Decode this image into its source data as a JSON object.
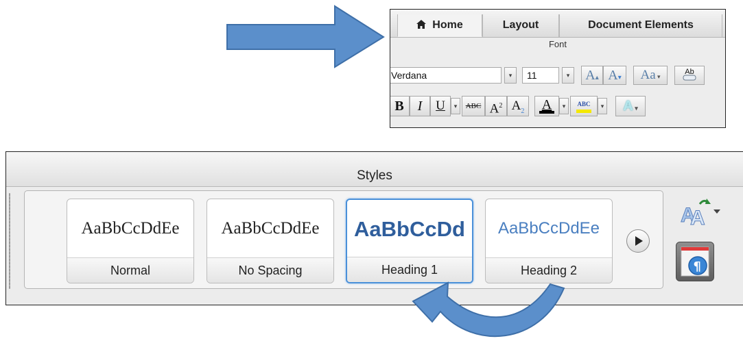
{
  "font_ribbon": {
    "tabs": [
      {
        "label": "Home",
        "icon": "home-icon",
        "active": true
      },
      {
        "label": "Layout",
        "active": false
      },
      {
        "label": "Document Elements",
        "active": false
      }
    ],
    "group_label": "Font",
    "font_name": "Verdana",
    "font_size": "11",
    "grow_font_glyph": "A",
    "shrink_font_glyph": "A",
    "change_case_glyph": "Aa",
    "clear_format_glyph": "Ab",
    "bold_glyph": "B",
    "italic_glyph": "I",
    "underline_glyph": "U",
    "strikethrough_glyph": "ABC",
    "superscript_glyph": "A",
    "superscript_mark": "2",
    "subscript_glyph": "A",
    "subscript_mark": "2",
    "font_color_glyph": "A",
    "highlight_glyph": "ABC",
    "text_effects_glyph": "A"
  },
  "styles_panel": {
    "title": "Styles",
    "styles": [
      {
        "sample": "AaBbCcDdEe",
        "label": "Normal",
        "selected": false
      },
      {
        "sample": "AaBbCcDdEe",
        "label": "No Spacing",
        "selected": false
      },
      {
        "sample": "AaBbCcDd",
        "label": "Heading 1",
        "selected": true
      },
      {
        "sample": "AaBbCcDdEe",
        "label": "Heading 2",
        "selected": false
      }
    ],
    "more_styles_icon": "play-circle-icon",
    "manage_styles_icon": "styles-aa-icon",
    "styles_pane_icon": "pilcrow-pane-icon"
  },
  "annotations": {
    "right_arrow_color": "#5b8fcb",
    "curved_arrow_color": "#5b8fcb"
  }
}
